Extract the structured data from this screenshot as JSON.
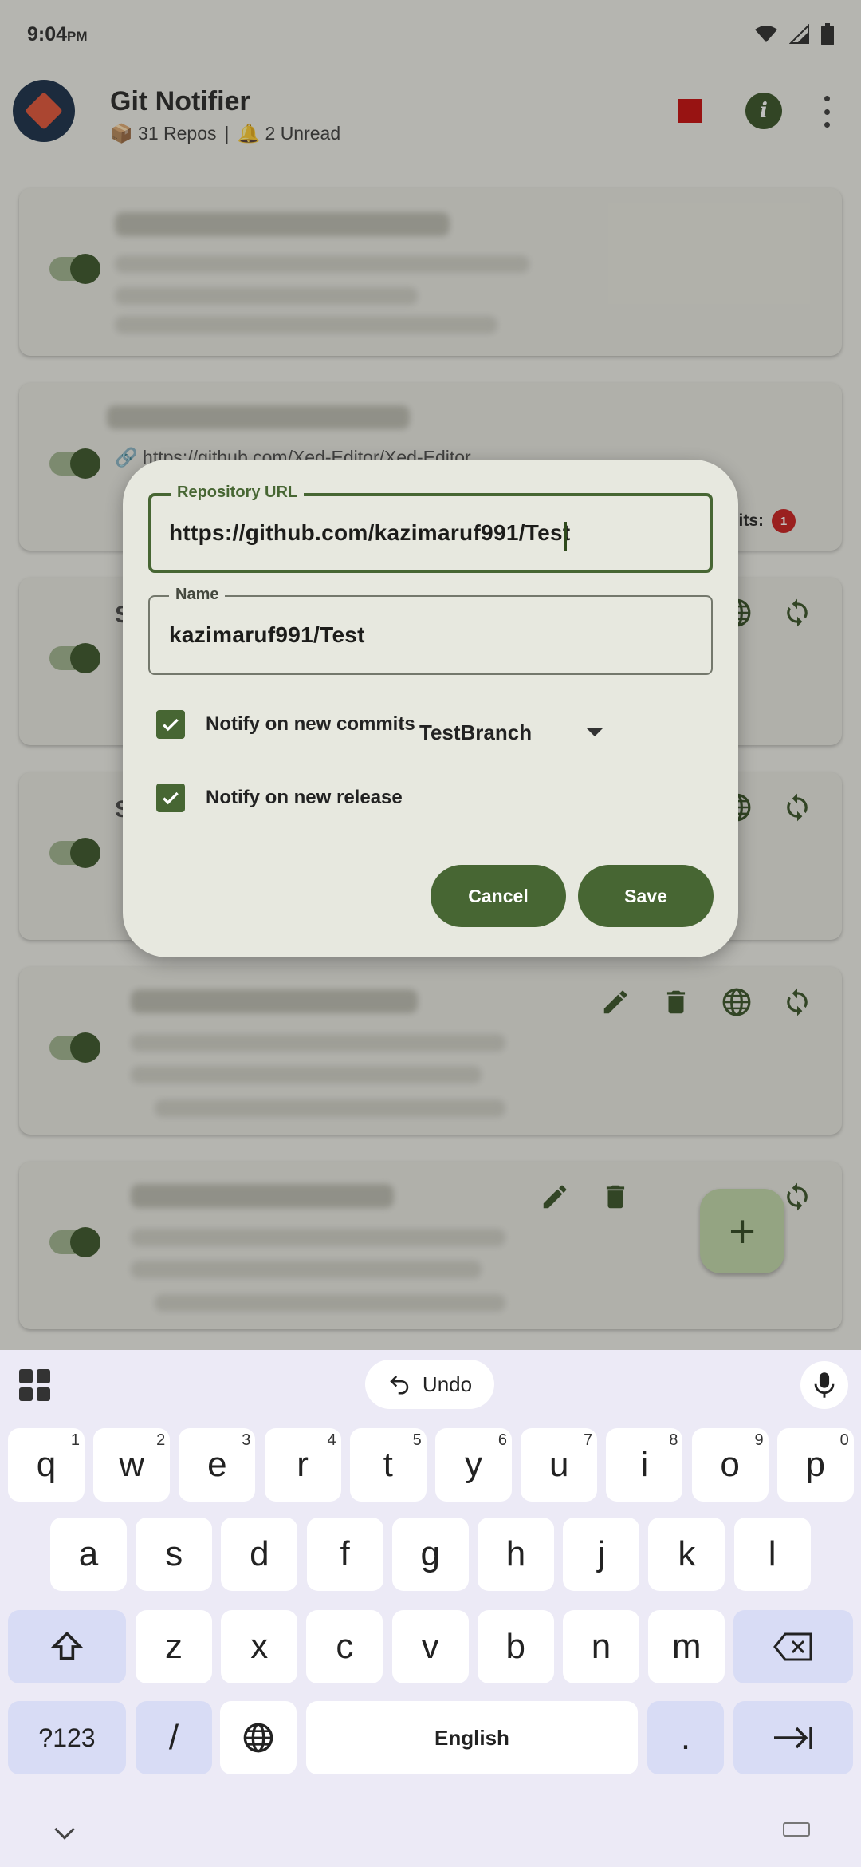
{
  "status": {
    "time": "9:04",
    "ampm": "PM"
  },
  "app": {
    "title": "Git Notifier",
    "repos_text": "📦 31 Repos",
    "separator": "|",
    "unread_text": "🔔 2 Unread"
  },
  "cards": [
    {
      "visible_letter": "",
      "url": "",
      "commits_label": ""
    },
    {
      "visible_letter": "",
      "url": "https://github.com/Xed-Editor/Xed-Editor",
      "commits_label": "mits:",
      "commits_count": "1"
    },
    {
      "visible_letter": "S"
    },
    {
      "visible_letter": "S"
    },
    {
      "visible_letter": ""
    },
    {
      "visible_letter": ""
    }
  ],
  "fab": {
    "label": "+"
  },
  "dialog": {
    "url_label": "Repository URL",
    "url_value": "https://github.com/kazimaruf991/Test",
    "name_label": "Name",
    "name_value": "kazimaruf991/Test",
    "notify_commits_label": "Notify on new commits",
    "notify_commits_checked": true,
    "branch_value": "TestBranch",
    "notify_release_label": "Notify on new release",
    "notify_release_checked": true,
    "cancel_label": "Cancel",
    "save_label": "Save",
    "accent_color": "#476633"
  },
  "keyboard": {
    "undo_label": "Undo",
    "row1": [
      {
        "k": "q",
        "h": "1"
      },
      {
        "k": "w",
        "h": "2"
      },
      {
        "k": "e",
        "h": "3"
      },
      {
        "k": "r",
        "h": "4"
      },
      {
        "k": "t",
        "h": "5"
      },
      {
        "k": "y",
        "h": "6"
      },
      {
        "k": "u",
        "h": "7"
      },
      {
        "k": "i",
        "h": "8"
      },
      {
        "k": "o",
        "h": "9"
      },
      {
        "k": "p",
        "h": "0"
      }
    ],
    "row2": [
      "a",
      "s",
      "d",
      "f",
      "g",
      "h",
      "j",
      "k",
      "l"
    ],
    "row3": [
      "z",
      "x",
      "c",
      "v",
      "b",
      "n",
      "m"
    ],
    "symbols_label": "?123",
    "slash_label": "/",
    "space_label": "English",
    "period_label": "."
  }
}
